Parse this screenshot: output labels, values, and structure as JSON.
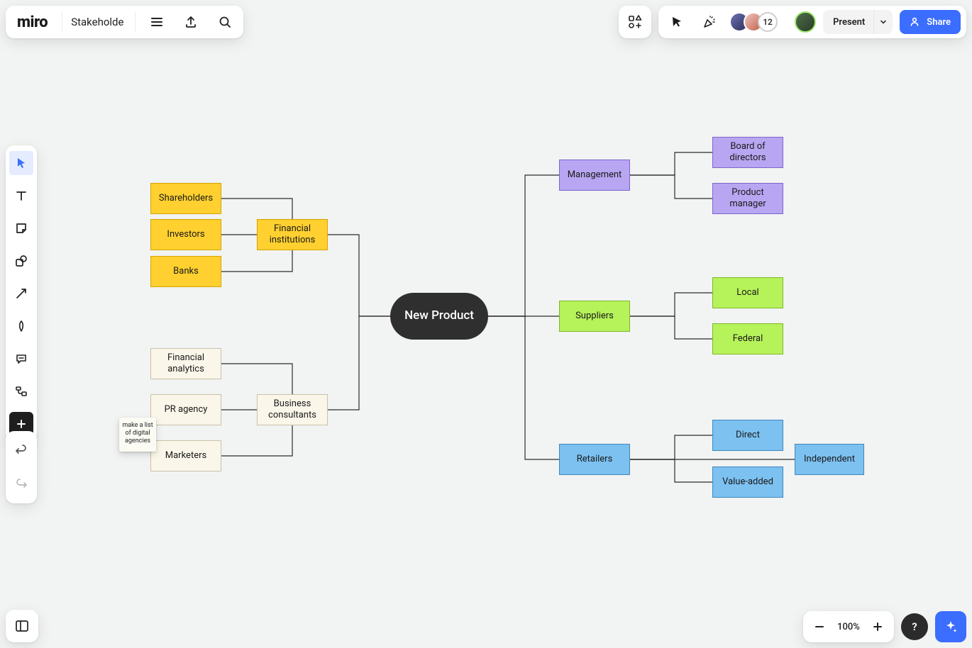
{
  "header": {
    "logo": "miro",
    "board_title": "Stakeholde"
  },
  "topright": {
    "overflow_count": "12",
    "present_label": "Present",
    "share_label": "Share"
  },
  "zoom": {
    "level": "100%",
    "help": "?"
  },
  "canvas": {
    "root": "New Product",
    "fin_inst": "Financial institutions",
    "shareholders": "Shareholders",
    "investors": "Investors",
    "banks": "Banks",
    "biz_cons": "Business consultants",
    "fin_analytics": "Financial analytics",
    "pr_agency": "PR agency",
    "marketers": "Marketers",
    "management": "Management",
    "board_dir": "Board of directors",
    "prod_mgr": "Product manager",
    "suppliers": "Suppliers",
    "local": "Local",
    "federal": "Federal",
    "retailers": "Retailers",
    "direct": "Direct",
    "value_added": "Value-added",
    "independent": "Independent",
    "sticky": "make a list of digital agencies"
  }
}
